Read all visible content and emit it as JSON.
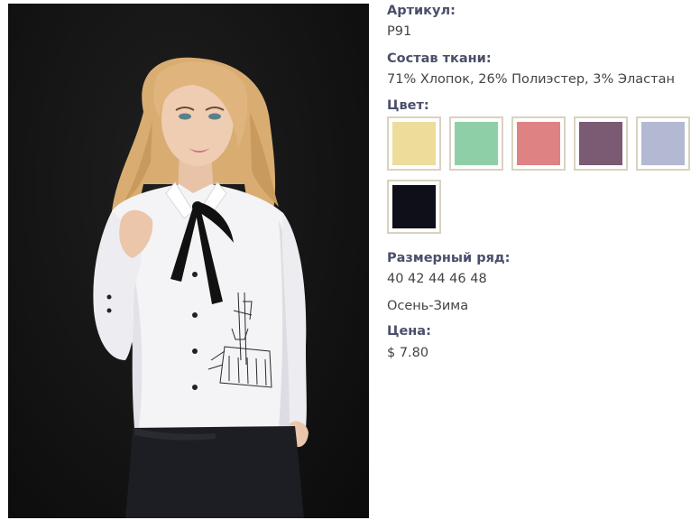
{
  "product": {
    "image_alt": "product-photo"
  },
  "details": {
    "sku_label": "Артикул:",
    "sku_value": "Р91",
    "composition_label": "Состав ткани:",
    "composition_value": "71% Хлопок, 26% Полиэстер, 3% Эластан",
    "color_label": "Цвет:",
    "colors": [
      {
        "name": "yellow",
        "hex": "#eedc9a"
      },
      {
        "name": "mint",
        "hex": "#8fcfa8"
      },
      {
        "name": "pink",
        "hex": "#de8284"
      },
      {
        "name": "plum",
        "hex": "#7a5b73"
      },
      {
        "name": "lavender",
        "hex": "#b3b8d3"
      },
      {
        "name": "black",
        "hex": "#0e0f18"
      }
    ],
    "sizes_label": "Размерный ряд:",
    "sizes_value": "40 42 44 46 48",
    "season": "Осень-Зима",
    "price_label": "Цена:",
    "price_value": "$ 7.80"
  }
}
